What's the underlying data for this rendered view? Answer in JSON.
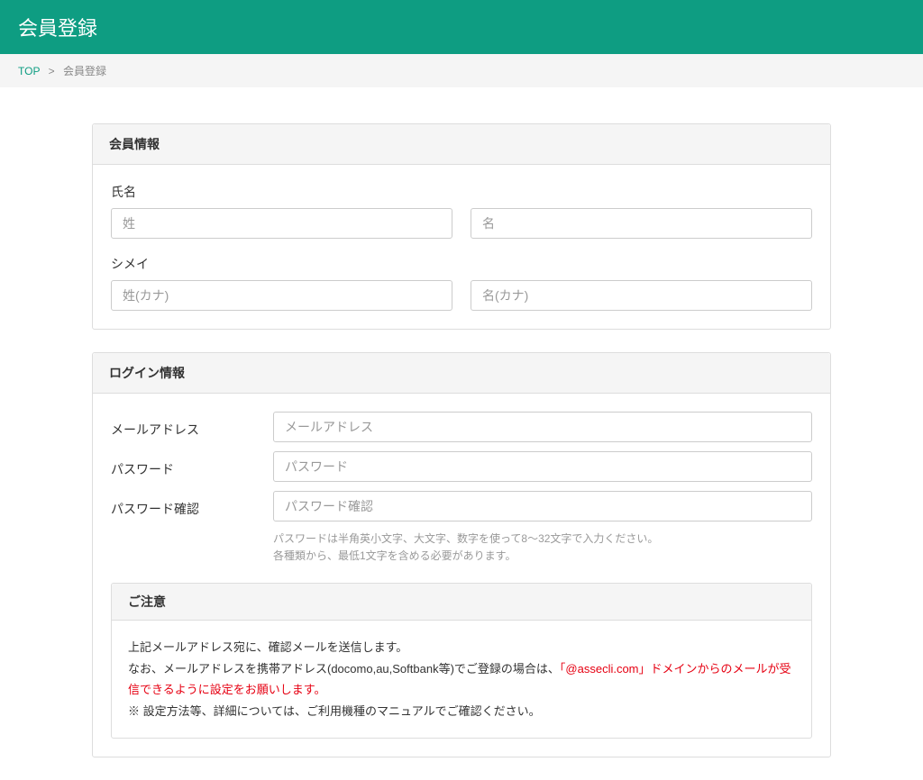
{
  "header": {
    "title": "会員登録"
  },
  "breadcrumb": {
    "top": "TOP",
    "separator": ">",
    "current": "会員登録"
  },
  "memberInfo": {
    "heading": "会員情報",
    "nameLabel": "氏名",
    "lastNamePlaceholder": "姓",
    "firstNamePlaceholder": "名",
    "kanaLabel": "シメイ",
    "lastNameKanaPlaceholder": "姓(カナ)",
    "firstNameKanaPlaceholder": "名(カナ)"
  },
  "loginInfo": {
    "heading": "ログイン情報",
    "emailLabel": "メールアドレス",
    "emailPlaceholder": "メールアドレス",
    "passwordLabel": "パスワード",
    "passwordPlaceholder": "パスワード",
    "passwordConfirmLabel": "パスワード確認",
    "passwordConfirmPlaceholder": "パスワード確認",
    "helpText1": "パスワードは半角英小文字、大文字、数字を使って8～32文字で入力ください。",
    "helpText2": "各種類から、最低1文字を含める必要があります。"
  },
  "notice": {
    "heading": "ご注意",
    "line1": "上記メールアドレス宛に、確認メールを送信します。",
    "line2a": "なお、メールアドレスを携帯アドレス(docomo,au,Softbank等)でご登録の場合は、",
    "line2b": "「@assecli.com」ドメインからのメールが受信できるように設定をお願いします。",
    "line3": "※ 設定方法等、詳細については、ご利用機種のマニュアルでご確認ください。"
  }
}
